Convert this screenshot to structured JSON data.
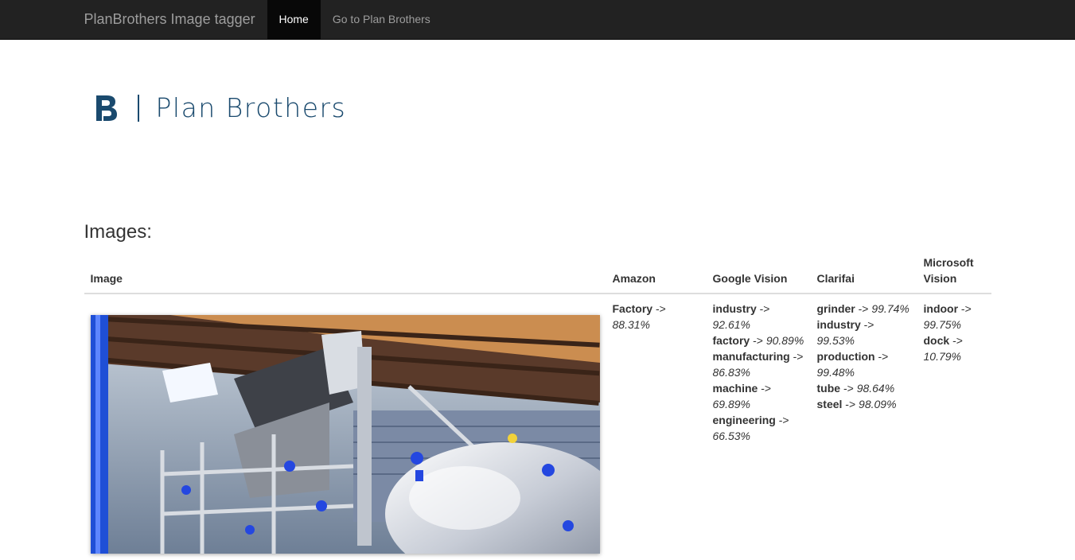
{
  "navbar": {
    "brand": "PlanBrothers Image tagger",
    "links": [
      {
        "label": "Home",
        "active": true
      },
      {
        "label": "Go to Plan Brothers",
        "active": false
      }
    ]
  },
  "logo": {
    "text": "Plan Brothers",
    "color": "#1a4a6e"
  },
  "section": {
    "heading": "Images:"
  },
  "table": {
    "headers": [
      "Image",
      "Amazon",
      "Google Vision",
      "Clarifai",
      "Microsoft Vision"
    ],
    "rows": [
      {
        "image_description": "factory-photo",
        "amazon": [
          {
            "tag": "Factory",
            "score": "88.31%"
          }
        ],
        "google_vision": [
          {
            "tag": "industry",
            "score": "92.61%"
          },
          {
            "tag": "factory",
            "score": "90.89%"
          },
          {
            "tag": "manufacturing",
            "score": "86.83%"
          },
          {
            "tag": "machine",
            "score": "69.89%"
          },
          {
            "tag": "engineering",
            "score": "66.53%"
          }
        ],
        "clarifai": [
          {
            "tag": "grinder",
            "score": "99.74%"
          },
          {
            "tag": "industry",
            "score": "99.53%"
          },
          {
            "tag": "production",
            "score": "99.48%"
          },
          {
            "tag": "tube",
            "score": "98.64%"
          },
          {
            "tag": "steel",
            "score": "98.09%"
          }
        ],
        "microsoft_vision": [
          {
            "tag": "indoor",
            "score": "99.75%"
          },
          {
            "tag": "dock",
            "score": "10.79%"
          }
        ]
      }
    ]
  },
  "colors": {
    "navbar_bg": "#222222",
    "active_link_bg": "#080808",
    "brand_blue": "#1a4a6e"
  }
}
